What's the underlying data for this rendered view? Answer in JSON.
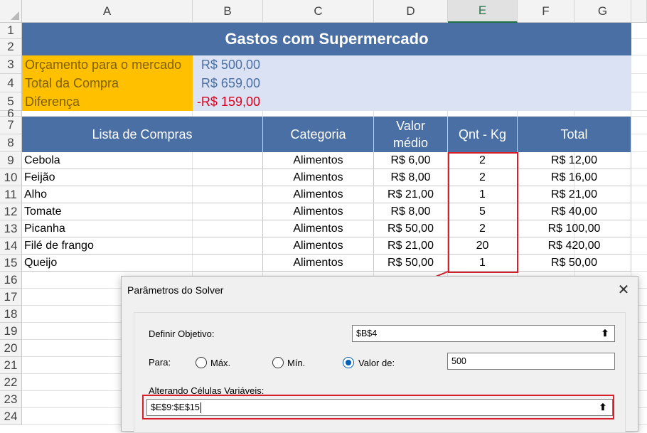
{
  "columns": [
    "A",
    "B",
    "C",
    "D",
    "E",
    "F",
    "G"
  ],
  "rows": [
    "1",
    "2",
    "3",
    "4",
    "5",
    "6",
    "7",
    "8",
    "9",
    "10",
    "11",
    "12",
    "13",
    "14",
    "15",
    "16",
    "17",
    "18",
    "19",
    "20",
    "21",
    "22",
    "23",
    "24"
  ],
  "title": "Gastos com Supermercado",
  "budget": [
    {
      "label": "Orçamento para o mercado",
      "value": "R$ 500,00",
      "color": "#4a6fa5"
    },
    {
      "label": "Total da Compra",
      "value": "R$ 659,00",
      "color": "#4a6fa5"
    },
    {
      "label": "Diferença",
      "value": "-R$ 159,00",
      "color": "#e0001b"
    }
  ],
  "table": {
    "headers": [
      "Lista de Compras",
      "Categoria",
      "Valor médio",
      "Qnt - Kg",
      "Total"
    ],
    "rows": [
      [
        "Cebola",
        "Alimentos",
        "R$ 6,00",
        "2",
        "R$ 12,00"
      ],
      [
        "Feijão",
        "Alimentos",
        "R$ 8,00",
        "2",
        "R$ 16,00"
      ],
      [
        "Alho",
        "Alimentos",
        "R$ 21,00",
        "1",
        "R$ 21,00"
      ],
      [
        "Tomate",
        "Alimentos",
        "R$ 8,00",
        "5",
        "R$ 40,00"
      ],
      [
        "Picanha",
        "Alimentos",
        "R$ 50,00",
        "2",
        "R$ 100,00"
      ],
      [
        "Filé de frango",
        "Alimentos",
        "R$ 21,00",
        "20",
        "R$ 420,00"
      ],
      [
        "Queijo",
        "Alimentos",
        "R$ 50,00",
        "1",
        "R$ 50,00"
      ]
    ]
  },
  "solver": {
    "title": "Parâmetros do Solver",
    "objective_label": "Definir Objetivo:",
    "objective_value": "$B$4",
    "to_label": "Para:",
    "max_label": "Máx.",
    "min_label": "Mín.",
    "value_of_label": "Valor de:",
    "value_of": "500",
    "selected": "value_of",
    "changing_label": "Alterando Células Variáveis:",
    "changing_value": "$E$9:$E$15"
  },
  "colors": {
    "accent_blue": "#4a6fa5",
    "highlight_red": "#d9202a",
    "orange": "#ffc000",
    "light_blue": "#dbe2f3"
  }
}
